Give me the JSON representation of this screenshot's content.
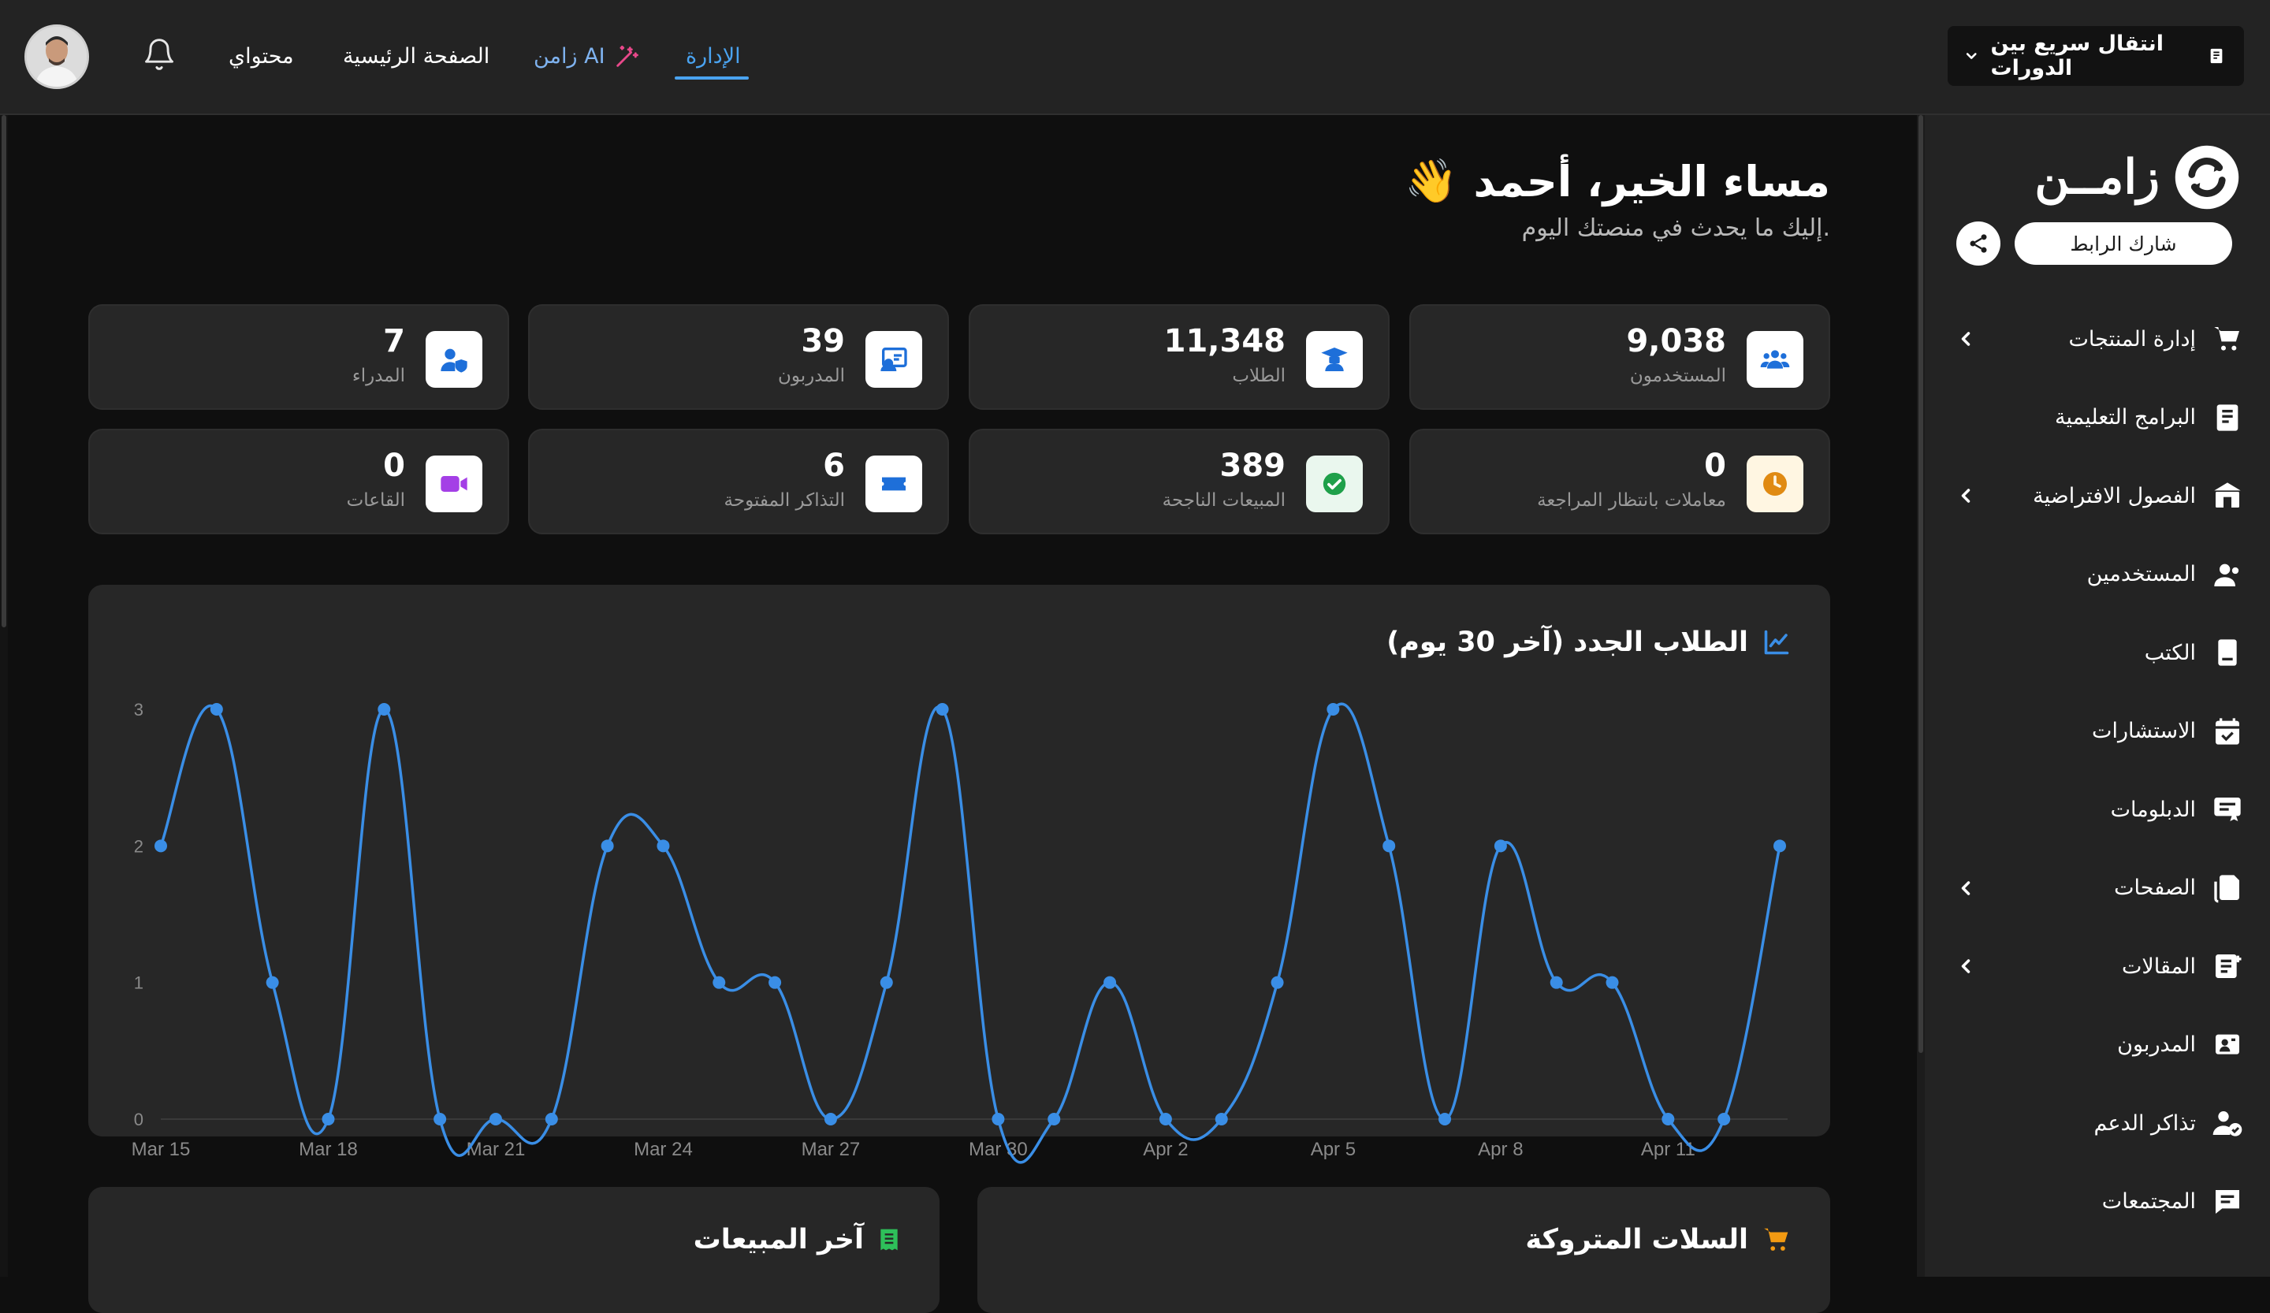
{
  "topbar": {
    "nav": {
      "admin": "الإدارة",
      "zamen_ai": "زامن AI",
      "home": "الصفحة الرئيسية",
      "my_content": "محتواي"
    },
    "quick_switch": "انتقال سريع بين الدورات"
  },
  "sidebar": {
    "logo_text": "زامــن",
    "share_link": "شارك الرابط",
    "items": [
      {
        "label": "إدارة المنتجات",
        "icon": "cart-icon",
        "has_submenu": true
      },
      {
        "label": "البرامج التعليمية",
        "icon": "document-icon",
        "has_submenu": false
      },
      {
        "label": "الفصول الافتراضية",
        "icon": "classroom-icon",
        "has_submenu": true
      },
      {
        "label": "المستخدمين",
        "icon": "users-icon",
        "has_submenu": false
      },
      {
        "label": "الكتب",
        "icon": "book-icon",
        "has_submenu": false
      },
      {
        "label": "الاستشارات",
        "icon": "calendar-icon",
        "has_submenu": false
      },
      {
        "label": "الدبلومات",
        "icon": "certificate-icon",
        "has_submenu": false
      },
      {
        "label": "الصفحات",
        "icon": "pages-icon",
        "has_submenu": true
      },
      {
        "label": "المقالات",
        "icon": "articles-icon",
        "has_submenu": true
      },
      {
        "label": "المدربون",
        "icon": "trainer-icon",
        "has_submenu": false
      },
      {
        "label": "تذاكر الدعم",
        "icon": "support-icon",
        "has_submenu": false
      },
      {
        "label": "المجتمعات",
        "icon": "chat-icon",
        "has_submenu": false
      }
    ]
  },
  "main": {
    "greeting": "مساء الخير، أحمد",
    "wave": "👋",
    "subtitle": "إليك ما يحدث في منصتك اليوم.",
    "stats": [
      {
        "value": "9,038",
        "label": "المستخدمون",
        "icon": "users-icon",
        "color": "#1e6fd9"
      },
      {
        "value": "11,348",
        "label": "الطلاب",
        "icon": "graduate-icon",
        "color": "#1e6fd9"
      },
      {
        "value": "39",
        "label": "المدربون",
        "icon": "trainer-icon",
        "color": "#1e6fd9"
      },
      {
        "value": "7",
        "label": "المدراء",
        "icon": "admin-icon",
        "color": "#1e6fd9"
      },
      {
        "value": "0",
        "label": "معاملات بانتظار المراجعة",
        "icon": "clock-icon",
        "color": "#e08a12"
      },
      {
        "value": "389",
        "label": "المبيعات الناجحة",
        "icon": "check-icon",
        "color": "#1fa04a"
      },
      {
        "value": "6",
        "label": "التذاكر المفتوحة",
        "icon": "ticket-icon",
        "color": "#1e6fd9"
      },
      {
        "value": "0",
        "label": "القاعات",
        "icon": "video-icon",
        "color": "#a43fe6"
      }
    ],
    "chart_title": "الطلاب الجدد (آخر 30 يوم)",
    "abandoned_carts": "السلات المتروكة",
    "latest_sales": "آخر المبيعات"
  },
  "colors": {
    "accent": "#4aa3f0",
    "line": "#3a8ee6",
    "background": "#0f0f0f",
    "card": "#272727"
  },
  "chart_data": {
    "type": "line",
    "title": "الطلاب الجدد (آخر 30 يوم)",
    "x": [
      "Mar 15",
      "Mar 16",
      "Mar 17",
      "Mar 18",
      "Mar 19",
      "Mar 20",
      "Mar 21",
      "Mar 22",
      "Mar 23",
      "Mar 24",
      "Mar 25",
      "Mar 26",
      "Mar 27",
      "Mar 28",
      "Mar 29",
      "Mar 30",
      "Mar 31",
      "Apr 1",
      "Apr 2",
      "Apr 3",
      "Apr 4",
      "Apr 5",
      "Apr 6",
      "Apr 7",
      "Apr 8",
      "Apr 9",
      "Apr 10",
      "Apr 11",
      "Apr 12",
      "Apr 13"
    ],
    "x_tick_labels": [
      "Mar 15",
      "Mar 18",
      "Mar 21",
      "Mar 24",
      "Mar 27",
      "Mar 30",
      "Apr 2",
      "Apr 5",
      "Apr 8",
      "Apr 11"
    ],
    "y": [
      2,
      3,
      1,
      0,
      3,
      0,
      0,
      0,
      2,
      2,
      1,
      1,
      0,
      1,
      3,
      0,
      0,
      1,
      0,
      0,
      1,
      3,
      2,
      0,
      2,
      1,
      1,
      0,
      0,
      2
    ],
    "yticks": [
      0,
      1,
      2,
      3
    ],
    "ylim": [
      0,
      3
    ],
    "grid": false,
    "legend": "none",
    "smooth": true
  }
}
